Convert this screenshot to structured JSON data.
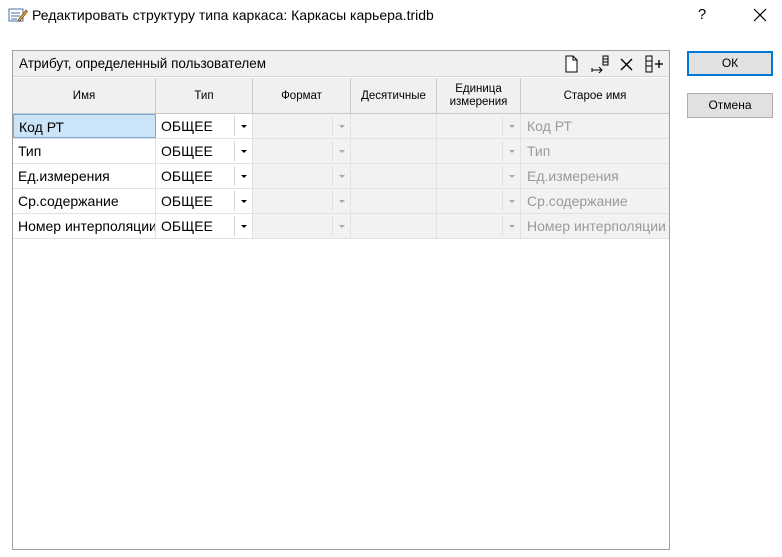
{
  "window": {
    "title": "Редактировать структуру типа каркаса: Каркасы карьера.tridb",
    "help_label": "?"
  },
  "panel": {
    "title": "Атрибут, определенный пользователем",
    "tools": [
      "new-doc-icon",
      "insert-row-icon",
      "delete-icon",
      "add-column-icon"
    ]
  },
  "columns": {
    "name": "Имя",
    "type": "Тип",
    "format": "Формат",
    "decimals": "Десятичные",
    "unit_line1": "Единица",
    "unit_line2": "измерения",
    "old_name": "Старое имя"
  },
  "rows": [
    {
      "name": "Код РТ",
      "type": "ОБЩЕЕ",
      "old_name": "Код РТ"
    },
    {
      "name": "Тип",
      "type": "ОБЩЕЕ",
      "old_name": "Тип"
    },
    {
      "name": "Ед.измерения",
      "type": "ОБЩЕЕ",
      "old_name": "Ед.измерения"
    },
    {
      "name": "Ср.содержание",
      "type": "ОБЩЕЕ",
      "old_name": "Ср.содержание"
    },
    {
      "name": "Номер интерполяции",
      "type": "ОБЩЕЕ",
      "old_name": "Номер интерполяции"
    }
  ],
  "buttons": {
    "ok": "ОК",
    "cancel": "Отмена"
  },
  "colors": {
    "selection": "#cce4f7",
    "default_button_border": "#0078d7"
  }
}
